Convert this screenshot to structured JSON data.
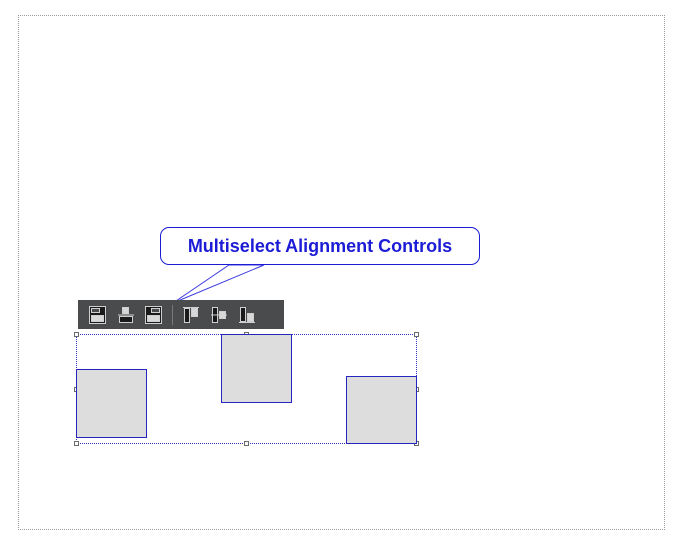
{
  "callout": {
    "text": "Multiselect Alignment Controls"
  },
  "toolbar": {
    "groups": [
      [
        "align-left-icon",
        "align-center-horizontal-icon",
        "align-right-icon"
      ],
      [
        "align-top-icon",
        "align-middle-vertical-icon",
        "align-bottom-icon"
      ]
    ]
  },
  "colors": {
    "accent": "#1c1cd6",
    "shape_fill": "#dddddd",
    "toolbar_bg": "#4a4b4c"
  }
}
